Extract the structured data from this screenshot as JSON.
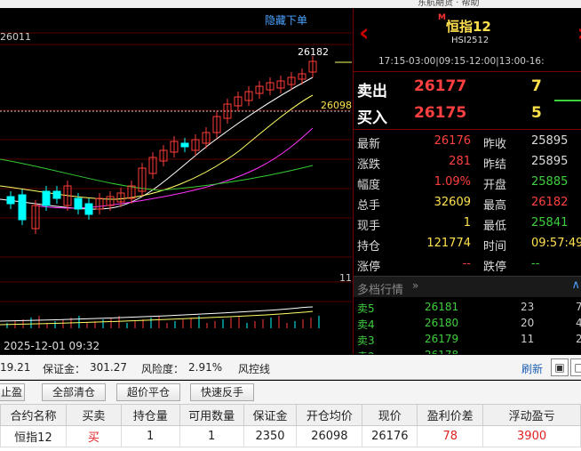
{
  "top_strip": {
    "text": "东航期货 · 帮助"
  },
  "chart": {
    "hide_orders_label": "隐藏下单",
    "label_left_top": "26011",
    "label_high": "26182",
    "label_avg": "26098",
    "label_vol_top": "11",
    "timestamp": "2025-12-01 09:32",
    "colors": {
      "up": "#ff3b3b",
      "down": "#00ffff",
      "ma5": "#ffffff",
      "ma10": "#ffff66",
      "ma20": "#ff33ff",
      "ma60": "#33cc33"
    }
  },
  "quote": {
    "m_badge": "M",
    "name": "恒指12",
    "code": "HSI2512",
    "sessions": "17:15-03:00|09:15-12:00|13:00-16:",
    "ask_label": "卖出",
    "ask_price": "26177",
    "ask_volume": "7",
    "bid_label": "买入",
    "bid_price": "26175",
    "bid_volume": "5",
    "rows": [
      {
        "l1": "最新",
        "v1": "26176",
        "c1": "#ff4040",
        "l2": "昨收",
        "v2": "25895",
        "c2": "#dddddd"
      },
      {
        "l1": "涨跌",
        "v1": "281",
        "c1": "#ff4040",
        "l2": "昨结",
        "v2": "25895",
        "c2": "#dddddd"
      },
      {
        "l1": "幅度",
        "v1": "1.09%",
        "c1": "#ff4040",
        "l2": "开盘",
        "v2": "25885",
        "c2": "#3ecf3e"
      },
      {
        "l1": "总手",
        "v1": "32609",
        "c1": "#ffe14d",
        "l2": "最高",
        "v2": "26182",
        "c2": "#ff4040"
      },
      {
        "l1": "现手",
        "v1": "1",
        "c1": "#ffe14d",
        "l2": "最低",
        "v2": "25841",
        "c2": "#3ecf3e"
      },
      {
        "l1": "持仓",
        "v1": "121774",
        "c1": "#ffe14d",
        "l2": "时间",
        "v2": "09:57:49",
        "c2": "#ffe14d"
      },
      {
        "l1": "涨停",
        "v1": "--",
        "c1": "#ff4040",
        "l2": "跌停",
        "v2": "--",
        "c2": "#3ecf3e"
      }
    ]
  },
  "depth": {
    "title": "多档行情",
    "rows": [
      {
        "label": "卖5",
        "price": "26181",
        "vol": "23",
        "extra": "7"
      },
      {
        "label": "卖4",
        "price": "26180",
        "vol": "20",
        "extra": "4"
      },
      {
        "label": "卖3",
        "price": "26179",
        "vol": "11",
        "extra": "2"
      },
      {
        "label": "卖2",
        "price": "26178",
        "vol": "",
        "extra": ""
      }
    ]
  },
  "account": {
    "balance_tail": "19.21",
    "margin_label": "保证金：",
    "margin_value": "301.27",
    "risk_label": "风险度：",
    "risk_value": "2.91%",
    "risk_control": "风控线",
    "refresh": "刷新"
  },
  "buttons": {
    "stop": "止盈",
    "close_all": "全部清仓",
    "super_close": "超价平仓",
    "quick_reverse": "快速反手"
  },
  "positions": {
    "headers": [
      "合约名称",
      "买卖",
      "持仓量",
      "可用数量",
      "保证金",
      "开仓均价",
      "现价",
      "盈利价差",
      "浮动盈亏"
    ],
    "rows": [
      [
        "恒指12",
        "买",
        "1",
        "1",
        "2350",
        "26098",
        "26176",
        "78",
        "3900"
      ]
    ]
  }
}
